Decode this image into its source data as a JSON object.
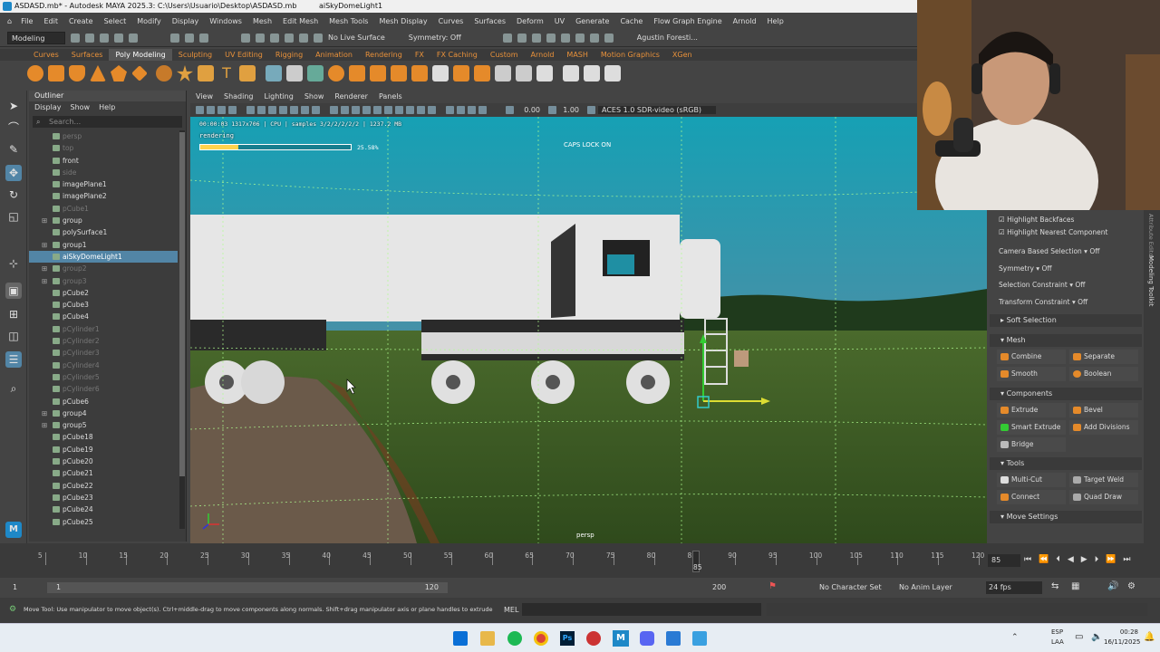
{
  "window": {
    "title": "ASDASD.mb* - Autodesk MAYA 2025.3: C:\\Users\\Usuario\\Desktop\\ASDASD.mb",
    "subtitle": "aiSkyDomeLight1"
  },
  "menubar": [
    "File",
    "Edit",
    "Create",
    "Select",
    "Modify",
    "Display",
    "Windows",
    "Mesh",
    "Edit Mesh",
    "Mesh Tools",
    "Mesh Display",
    "Curves",
    "Surfaces",
    "Deform",
    "UV",
    "Generate",
    "Cache",
    "Flow Graph Engine",
    "Arnold",
    "Help"
  ],
  "statusline": {
    "mode": "Modeling",
    "live_surface": "No Live Surface",
    "symmetry": "Symmetry: Off",
    "user": "Agustin Foresti..."
  },
  "shelf_tabs": [
    "Curves",
    "Surfaces",
    "Poly Modeling",
    "Sculpting",
    "UV Editing",
    "Rigging",
    "Animation",
    "Rendering",
    "FX",
    "FX Caching",
    "Custom",
    "Arnold",
    "MASH",
    "Motion Graphics",
    "XGen"
  ],
  "shelf_active": "Poly Modeling",
  "outliner": {
    "title": "Outliner",
    "menu": [
      "Display",
      "Show",
      "Help"
    ],
    "search_placeholder": "Search...",
    "items": [
      {
        "label": "persp",
        "dim": true
      },
      {
        "label": "top",
        "dim": true
      },
      {
        "label": "front",
        "dim": false
      },
      {
        "label": "side",
        "dim": true
      },
      {
        "label": "imagePlane1",
        "dim": false
      },
      {
        "label": "imagePlane2",
        "dim": false
      },
      {
        "label": "pCube1",
        "dim": true
      },
      {
        "label": "group",
        "dim": false
      },
      {
        "label": "polySurface1",
        "dim": false
      },
      {
        "label": "group1",
        "dim": false
      },
      {
        "label": "aiSkyDomeLight1",
        "dim": false,
        "selected": true
      },
      {
        "label": "group2",
        "dim": true
      },
      {
        "label": "group3",
        "dim": true
      },
      {
        "label": "pCube2",
        "dim": false
      },
      {
        "label": "pCube3",
        "dim": false
      },
      {
        "label": "pCube4",
        "dim": false
      },
      {
        "label": "pCylinder1",
        "dim": true
      },
      {
        "label": "pCylinder2",
        "dim": true
      },
      {
        "label": "pCylinder3",
        "dim": true
      },
      {
        "label": "pCylinder4",
        "dim": true
      },
      {
        "label": "pCylinder5",
        "dim": true
      },
      {
        "label": "pCylinder6",
        "dim": true
      },
      {
        "label": "pCube6",
        "dim": false
      },
      {
        "label": "group4",
        "dim": false
      },
      {
        "label": "group5",
        "dim": false
      },
      {
        "label": "pCube18",
        "dim": false
      },
      {
        "label": "pCube19",
        "dim": false
      },
      {
        "label": "pCube20",
        "dim": false
      },
      {
        "label": "pCube21",
        "dim": false
      },
      {
        "label": "pCube22",
        "dim": false
      },
      {
        "label": "pCube23",
        "dim": false
      },
      {
        "label": "pCube24",
        "dim": false
      },
      {
        "label": "pCube25",
        "dim": false
      }
    ]
  },
  "viewport": {
    "menu": [
      "View",
      "Shading",
      "Lighting",
      "Show",
      "Renderer",
      "Panels"
    ],
    "exposure": "0.00",
    "gamma": "1.00",
    "colorspace": "ACES 1.0 SDR-video (sRGB)",
    "hud_stats": "00:00:03 1317x706 | CPU | samples 3/2/2/2/2/2 | 1237.2 MB",
    "hud_status": "rendering",
    "hud_progress": 25.58,
    "hud_progress_label": "25.58%",
    "caps_lock": "CAPS LOCK ON",
    "camera": "persp"
  },
  "modeling_toolkit": {
    "highlight_backfaces": "Highlight Backfaces",
    "highlight_nearest": "Highlight Nearest Component",
    "camera_based": "Camera Based Selection",
    "camera_based_val": "Off",
    "symmetry": "Symmetry",
    "symmetry_val": "Off",
    "selection_constraint": "Selection Constraint",
    "selection_constraint_val": "Off",
    "transform_constraint": "Transform Constraint",
    "transform_constraint_val": "Off",
    "soft_selection": "Soft Selection",
    "mesh": "Mesh",
    "combine": "Combine",
    "separate": "Separate",
    "smooth": "Smooth",
    "boolean": "Boolean",
    "components": "Components",
    "extrude": "Extrude",
    "bevel": "Bevel",
    "smart_extrude": "Smart Extrude",
    "add_divisions": "Add Divisions",
    "bridge": "Bridge",
    "tools": "Tools",
    "multicut": "Multi-Cut",
    "target_weld": "Target Weld",
    "connect": "Connect",
    "quad_draw": "Quad Draw",
    "move_settings": "Move Settings",
    "side_tab_1": "Attribute Editor",
    "side_tab_2": "Modeling Toolkit"
  },
  "timeline": {
    "ticks": [
      5,
      10,
      15,
      20,
      25,
      30,
      35,
      40,
      45,
      50,
      55,
      60,
      65,
      70,
      75,
      80,
      85,
      90,
      95,
      100,
      105,
      110,
      115,
      120
    ],
    "current_frame": "85",
    "current_frame_field": "85"
  },
  "range": {
    "start": "1",
    "start_inner": "1",
    "end_inner": "120",
    "end": "200",
    "character_set": "No Character Set",
    "anim_layer": "No Anim Layer",
    "fps": "24 fps"
  },
  "helpline": {
    "text": "Move Tool: Use manipulator to move object(s). Ctrl+middle-drag to move components along normals. Shift+drag manipulator axis or plane handles to extrude components or c",
    "mel": "MEL"
  },
  "taskbar": {
    "lang": "ESP",
    "lang2": "LAA",
    "time": "00:28",
    "date": "16/11/2025"
  }
}
